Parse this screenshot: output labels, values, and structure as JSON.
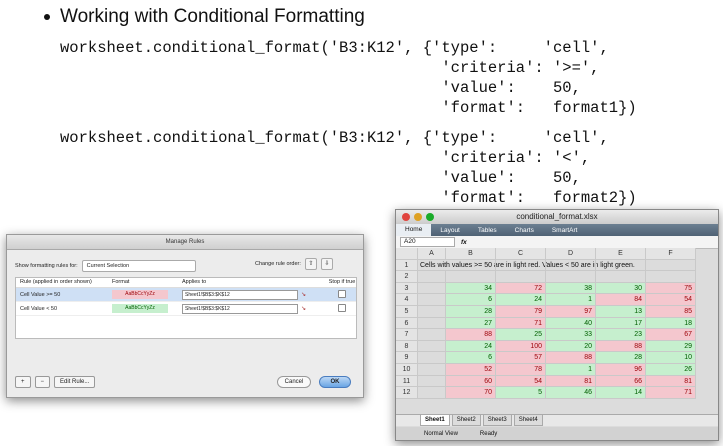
{
  "heading": "Working with Conditional Formatting",
  "code_blocks": [
    "worksheet.conditional_format('B3:K12', {'type':     'cell',\n                                         'criteria': '>=',\n                                         'value':    50,\n                                         'format':   format1})",
    "worksheet.conditional_format('B3:K12', {'type':     'cell',\n                                         'criteria': '<',\n                                         'value':    50,\n                                         'format':   format2})"
  ],
  "dialog": {
    "title": "Manage Rules",
    "show_label": "Show formatting rules for:",
    "show_value": "Current Selection",
    "change_order_label": "Change rule order:",
    "up_glyph": "⇧",
    "down_glyph": "⇩",
    "columns": [
      "Rule (applied in order shown)",
      "Format",
      "Applies to",
      "Stop if true"
    ],
    "rules": [
      {
        "rule": "Cell Value >= 50",
        "format": "AaBbCcYyZz",
        "applies": "Sheet1!$B$3:$K$12",
        "fmt_bg": "#f4c7ce",
        "fmt_fg": "#9c0006"
      },
      {
        "rule": "Cell Value < 50",
        "format": "AaBbCcYyZz",
        "applies": "Sheet1!$B$3:$K$12",
        "fmt_bg": "#c6efce",
        "fmt_fg": "#006100"
      }
    ],
    "add_label": "+",
    "remove_label": "−",
    "edit_label": "Edit Rule...",
    "cancel_label": "Cancel",
    "ok_label": "OK"
  },
  "excel": {
    "title": "conditional_format.xlsx",
    "ribbon": [
      "Home",
      "Layout",
      "Tables",
      "Charts",
      "SmartArt"
    ],
    "cell_ref": "A20",
    "fx_label": "fx",
    "columns": [
      "A",
      "B",
      "C",
      "D",
      "E",
      "F"
    ],
    "row1_text": "Cells with values >= 50 are in light red. Values < 50 are in light green.",
    "rows": [
      [],
      [
        34,
        72,
        38,
        30,
        75
      ],
      [
        6,
        24,
        1,
        84,
        54
      ],
      [
        28,
        79,
        97,
        13,
        85
      ],
      [
        27,
        71,
        40,
        17,
        18
      ],
      [
        88,
        25,
        33,
        23,
        67
      ],
      [
        24,
        100,
        20,
        88,
        29
      ],
      [
        6,
        57,
        88,
        28,
        10
      ],
      [
        52,
        78,
        1,
        96,
        26
      ],
      [
        60,
        54,
        81,
        66,
        81
      ],
      [
        70,
        5,
        46,
        14,
        71
      ]
    ],
    "sheets": [
      "Sheet1",
      "Sheet2",
      "Sheet3",
      "Sheet4"
    ],
    "status": [
      "Normal View",
      "Ready"
    ],
    "red": "#f4c7ce",
    "green": "#c6efce"
  }
}
